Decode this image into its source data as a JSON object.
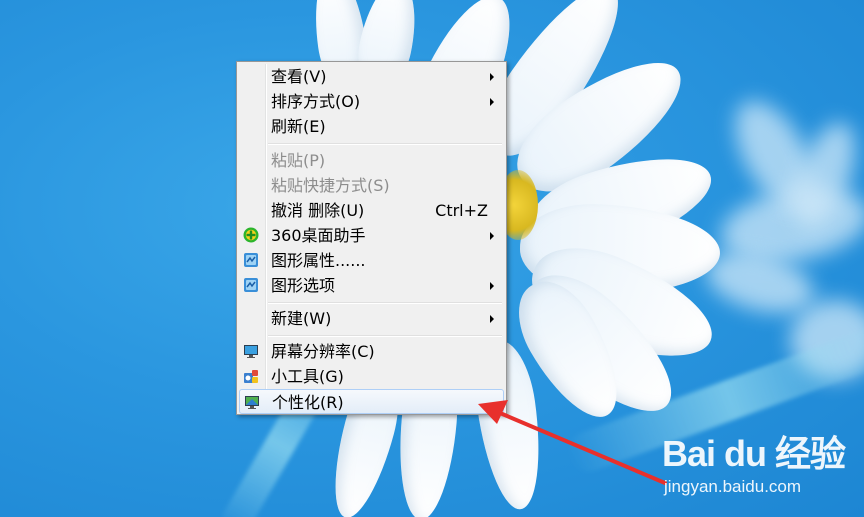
{
  "context_menu": {
    "items": [
      {
        "label": "查看(V)",
        "submenu": true
      },
      {
        "label": "排序方式(O)",
        "submenu": true
      },
      {
        "label": "刷新(E)"
      },
      {
        "label": "粘贴(P)",
        "disabled": true
      },
      {
        "label": "粘贴快捷方式(S)",
        "disabled": true
      },
      {
        "label": "撤消 删除(U)",
        "shortcut": "Ctrl+Z"
      },
      {
        "label": "360桌面助手",
        "submenu": true,
        "icon": "360-plus-icon"
      },
      {
        "label": "图形属性......",
        "icon": "graphics-icon"
      },
      {
        "label": "图形选项",
        "submenu": true,
        "icon": "graphics-icon"
      },
      {
        "label": "新建(W)",
        "submenu": true
      },
      {
        "label": "屏幕分辨率(C)",
        "icon": "monitor-icon"
      },
      {
        "label": "小工具(G)",
        "icon": "gadgets-icon"
      },
      {
        "label": "个性化(R)",
        "icon": "personalize-icon",
        "highlighted": true
      }
    ]
  },
  "watermark": {
    "logo": "Bai du 经验",
    "url": "jingyan.baidu.com"
  },
  "colors": {
    "desktop_blue": "#2a96df",
    "annotation_arrow": "#e8302c",
    "menu_bg": "#f0f0f0"
  }
}
